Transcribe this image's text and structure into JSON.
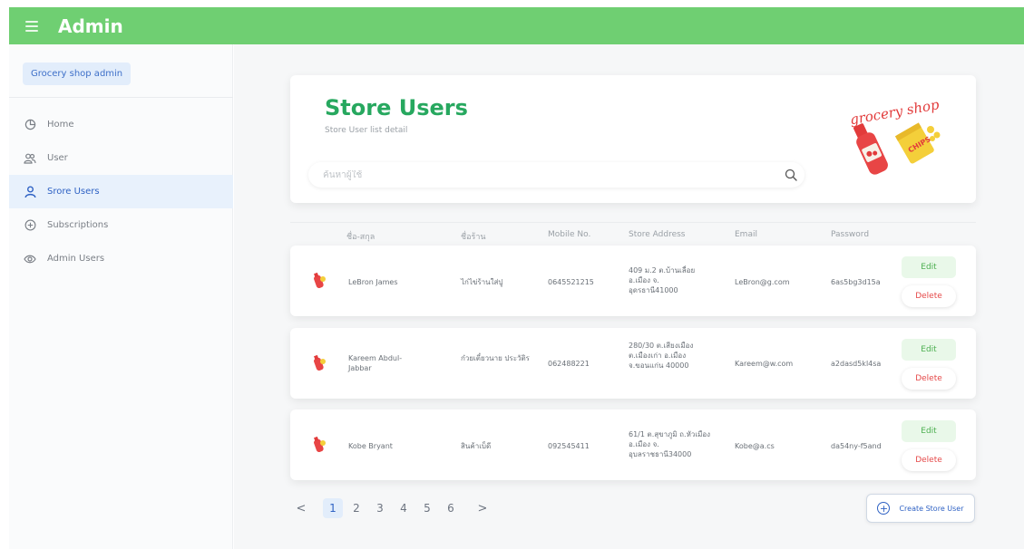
{
  "header": {
    "title": "Admin"
  },
  "sidebar": {
    "shop_name": "Grocery shop admin",
    "items": [
      {
        "label": "Home",
        "icon": "pie-chart-icon"
      },
      {
        "label": "User",
        "icon": "users-icon"
      },
      {
        "label": "Srore Users",
        "icon": "user-icon",
        "active": true
      },
      {
        "label": "Subscriptions",
        "icon": "plus-circle-icon"
      },
      {
        "label": "Admin Users",
        "icon": "eye-icon"
      }
    ]
  },
  "page": {
    "title": "Store Users",
    "subtitle": "Store User list detail",
    "search_placeholder": "ค้นหาผู้ใช้",
    "logo_text": "grocery shop"
  },
  "table": {
    "headers": {
      "name": "ชื่อ-สกุล",
      "store": "ชื่อร้าน",
      "mobile": "Mobile No.",
      "address": "Store Address",
      "email": "Email",
      "password": "Password"
    },
    "rows": [
      {
        "name": "LeBron James",
        "store": "ไก่ไข่ร้านใส่ปู",
        "mobile": "0645521215",
        "address": "409 ม.2 ต.บ้านเลื่อย อ.เมือง จ. อุดรธานี41000",
        "email": "LeBron@g.com",
        "password": "6as5bg3d15a"
      },
      {
        "name": "Kareem Abdul-Jabbar",
        "store": "ก๋วยเตี๋ยวนาย ประวัติร",
        "mobile": "062488221",
        "address": "280/30 ต.เสียงเมือง ต.เมืองเก่า อ.เมือง จ.ขอนแก่น 40000",
        "email": "Kareem@w.com",
        "password": "a2dasd5kl4sa"
      },
      {
        "name": "Kobe Bryant",
        "store": "สินค้าเบ็ดี",
        "mobile": "092545411",
        "address": "61/1 ต.สุขาภูมิ ถ.หัวเมือง อ.เมือง จ. อุบลราชธานี34000",
        "email": "Kobe@a.cs",
        "password": "da54ny-f5and"
      }
    ],
    "edit_label": "Edit",
    "delete_label": "Delete"
  },
  "pagination": {
    "prev": "<",
    "next": ">",
    "pages": [
      "1",
      "2",
      "3",
      "4",
      "5",
      "6"
    ],
    "current": "1"
  },
  "create_button": {
    "label": "Create Store User"
  },
  "colors": {
    "topbar": "#6fcf72",
    "title_green": "#27a85f",
    "accent_blue": "#2f62c4",
    "delete_red": "#e54848"
  }
}
